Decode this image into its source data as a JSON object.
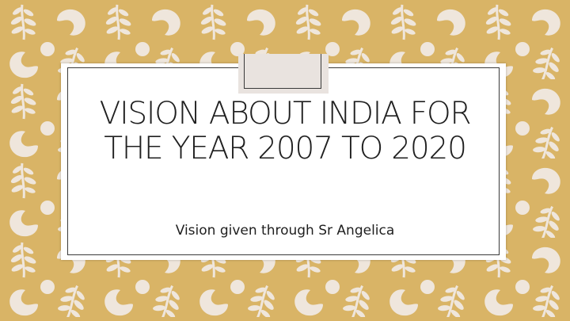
{
  "slide": {
    "title": "VISION ABOUT INDIA FOR THE YEAR 2007 TO 2020",
    "subtitle": "Vision given through Sr Angelica"
  },
  "theme": {
    "background_color": "#d9b466",
    "pattern_color": "#efe6dc",
    "card_color": "#ffffff",
    "border_color": "#3a3a3a",
    "tab_color": "#e9e3df",
    "pattern_icons": [
      "leaf-sprig-icon",
      "paisley-swirl-icon",
      "dot-icon"
    ]
  }
}
